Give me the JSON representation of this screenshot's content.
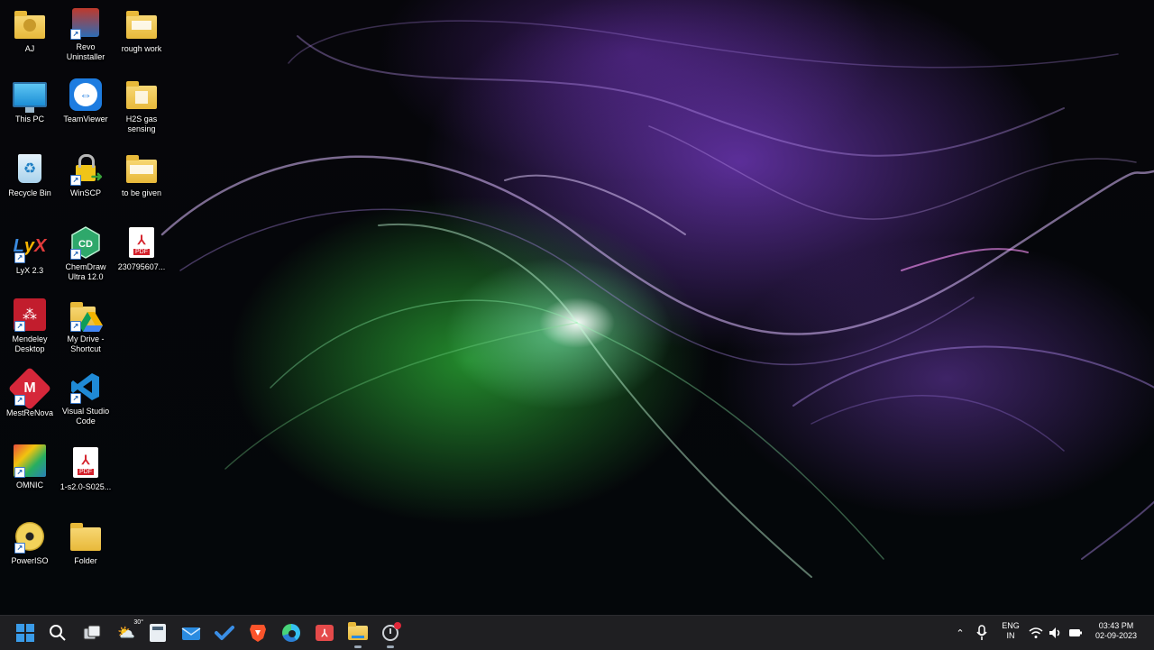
{
  "desktop": {
    "icons": [
      {
        "label": "AJ"
      },
      {
        "label": "Revo Uninstaller"
      },
      {
        "label": "rough work"
      },
      {
        "label": "This PC"
      },
      {
        "label": "TeamViewer"
      },
      {
        "label": "H2S gas sensing"
      },
      {
        "label": "Recycle Bin"
      },
      {
        "label": "WinSCP"
      },
      {
        "label": "to be given"
      },
      {
        "label": "LyX 2.3"
      },
      {
        "label": "ChemDraw Ultra 12.0"
      },
      {
        "label": "230795607..."
      },
      {
        "label": "Mendeley Desktop"
      },
      {
        "label": "My Drive - Shortcut"
      },
      {
        "label": "MestReNova"
      },
      {
        "label": "Visual Studio Code"
      },
      {
        "label": "OMNIC"
      },
      {
        "label": "1-s2.0-S025..."
      },
      {
        "label": "PowerISO"
      },
      {
        "label": "Folder"
      }
    ]
  },
  "taskbar": {
    "weather_temp": "30°",
    "language": {
      "line1": "ENG",
      "line2": "IN"
    },
    "clock": {
      "time": "03:43 PM",
      "date": "02-09-2023"
    },
    "colors": {
      "bg": "#1f1f22",
      "accent": "#3a8ee6"
    }
  }
}
